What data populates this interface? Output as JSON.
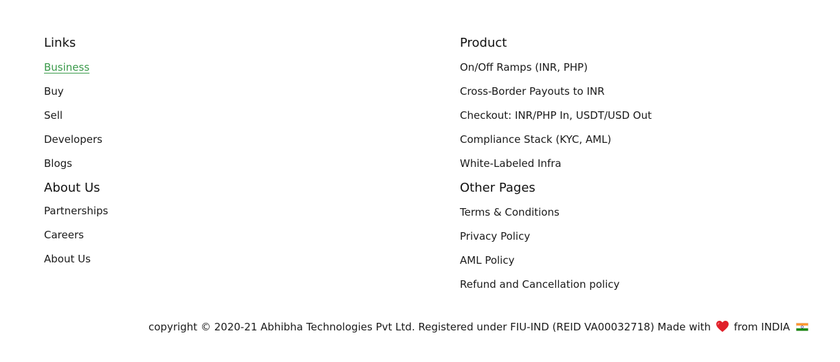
{
  "links": {
    "title": "Links",
    "items": [
      {
        "label": "Business",
        "active": true
      },
      {
        "label": "Buy"
      },
      {
        "label": "Sell"
      },
      {
        "label": "Developers"
      },
      {
        "label": "Blogs"
      }
    ]
  },
  "about": {
    "title": "About Us",
    "items": [
      {
        "label": "Partnerships"
      },
      {
        "label": "Careers"
      },
      {
        "label": "About Us"
      }
    ]
  },
  "product": {
    "title": "Product",
    "items": [
      {
        "label": "On/Off Ramps (INR, PHP)"
      },
      {
        "label": "Cross-Border Payouts to INR"
      },
      {
        "label": "Checkout: INR/PHP In, USDT/USD Out"
      },
      {
        "label": "Compliance Stack (KYC, AML)"
      },
      {
        "label": "White-Labeled Infra"
      }
    ]
  },
  "other_pages": {
    "title": "Other Pages",
    "items": [
      {
        "label": "Terms & Conditions"
      },
      {
        "label": "Privacy Policy"
      },
      {
        "label": "AML Policy"
      },
      {
        "label": "Refund and Cancellation policy"
      }
    ]
  },
  "copyright": {
    "text_before": "copyright © 2020-21 Abhibha Technologies Pvt Ltd. Registered under FIU-IND (REID VA00032718) Made with",
    "text_after": "from INDIA",
    "heart_icon": "heart-icon",
    "flag_icon": "india-flag-icon"
  },
  "colors": {
    "active_link": "#3a9a4a",
    "text": "#1a1a1a",
    "heart": "#e0202a",
    "flag_saffron": "#ff9933",
    "flag_green": "#138808",
    "flag_chakra": "#000080"
  }
}
